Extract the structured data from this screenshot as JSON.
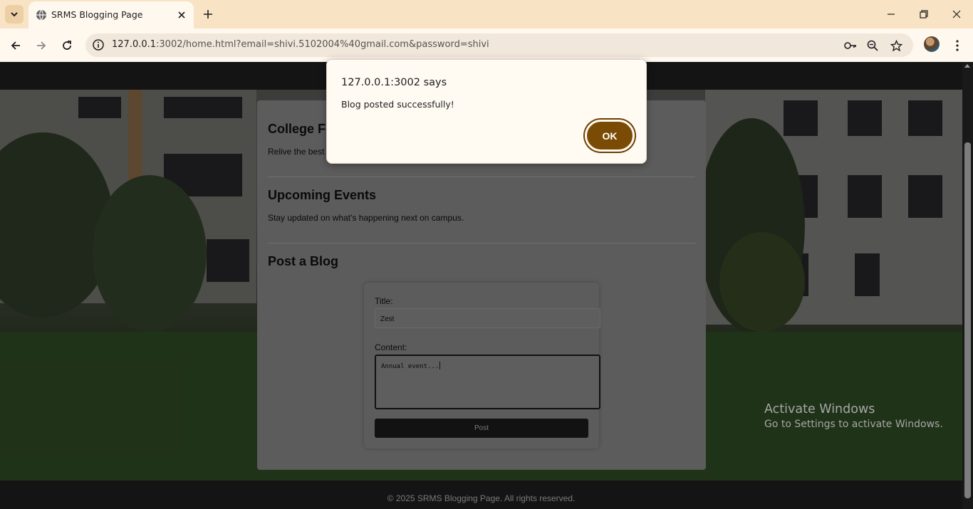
{
  "browser": {
    "tab": {
      "title": "SRMS Blogging Page"
    },
    "address": {
      "host": "127.0.0.1",
      "rest": ":3002/home.html?email=shivi.5102004%40gmail.com&password=shivi"
    }
  },
  "content": {
    "sections": [
      {
        "heading": "College Fe",
        "text": "Relive the best"
      },
      {
        "heading": "Upcoming Events",
        "text": "Stay updated on what's happening next on campus."
      },
      {
        "heading": "Post a Blog"
      }
    ],
    "form": {
      "title_label": "Title:",
      "title_value": "Zest",
      "content_label": "Content:",
      "content_value": "Annual event...",
      "post_label": "Post"
    }
  },
  "footer": {
    "text": "© 2025 SRMS Blogging Page. All rights reserved."
  },
  "dialog": {
    "origin": "127.0.0.1:3002 says",
    "message": "Blog posted successfully!",
    "ok_label": "OK"
  },
  "watermark": {
    "line1": "Activate Windows",
    "line2": "Go to Settings to activate Windows."
  },
  "colors": {
    "tabbar": "#f8e3c4",
    "ok_button": "#7a4b04"
  }
}
